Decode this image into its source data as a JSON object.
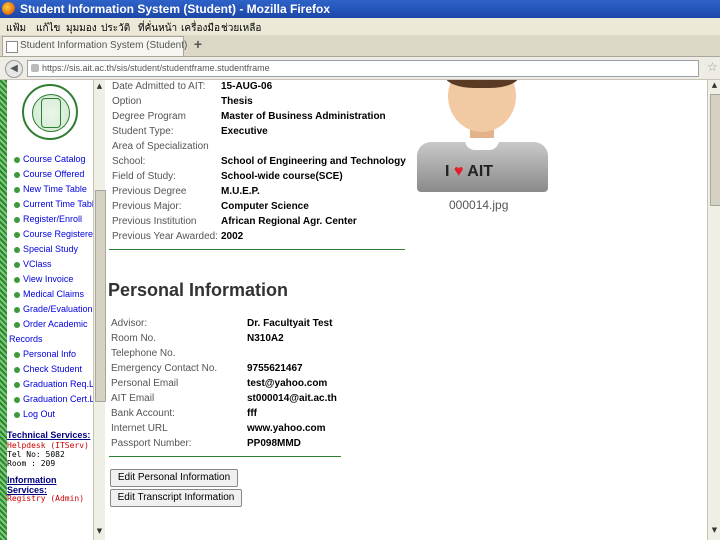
{
  "window": {
    "title": "Student Information System (Student) - Mozilla Firefox"
  },
  "menu": {
    "items": [
      "แฟ้ม",
      "แก้ไข",
      "มุมมอง",
      "ประวัติ",
      "ที่คั่นหน้า",
      "เครื่องมือ",
      "ช่วยเหลือ"
    ]
  },
  "tab": {
    "label": "Student Information System (Student)",
    "new_tab": "+"
  },
  "nav": {
    "url": "https://sis.ait.ac.th/sis/student/studentframe.studentframe"
  },
  "sidebar": {
    "items": [
      "Course Catalog",
      "Course Offered",
      "New Time Table",
      "Current Time Table",
      "Register/Enroll",
      "Course Registered",
      "Special Study",
      "VClass",
      "View Invoice",
      "Medical Claims",
      "Grade/Evaluation",
      "Order Academic"
    ],
    "records": "Records",
    "items2": [
      "Personal Info",
      "Check Student",
      "Graduation Req.Link",
      "Graduation Cert.Link",
      "Log Out"
    ],
    "tech": {
      "heading": "Technical Services:",
      "line1": "Helpdesk (ITServ)",
      "line2": "Tel No: 5082",
      "line3": "Room : 209"
    },
    "infoserv": {
      "heading1": "Information",
      "heading2": "Services:",
      "line1": "Registry (Admin)"
    }
  },
  "academic": [
    {
      "label": "Date Admitted to AIT:",
      "value": "15-AUG-06"
    },
    {
      "label": "Option",
      "value": "Thesis"
    },
    {
      "label": "Degree Program",
      "value": "Master of Business Administration"
    },
    {
      "label": "Student Type:",
      "value": "Executive"
    },
    {
      "label": "Area of Specialization",
      "value": ""
    },
    {
      "label": "School:",
      "value": "School of Engineering and Technology"
    },
    {
      "label": "Field of Study:",
      "value": "School-wide course(SCE)"
    },
    {
      "label": "Previous Degree",
      "value": "M.U.E.P."
    },
    {
      "label": "Previous Major:",
      "value": "Computer Science"
    },
    {
      "label": "Previous Institution",
      "value": "African Regional Agr. Center"
    },
    {
      "label": "Previous Year Awarded:",
      "value": "2002"
    }
  ],
  "personal": {
    "title": "Personal Information",
    "rows": [
      {
        "label": "Advisor:",
        "value": "Dr. Facultyait Test"
      },
      {
        "label": "Room No.",
        "value": "N310A2"
      },
      {
        "label": "Telephone No.",
        "value": ""
      },
      {
        "label": "Emergency Contact No.",
        "value": "9755621467"
      },
      {
        "label": "Personal Email",
        "value": "test@yahoo.com"
      },
      {
        "label": "AIT Email",
        "value": "st000014@ait.ac.th"
      },
      {
        "label": "Bank Account:",
        "value": "fff"
      },
      {
        "label": "Internet URL",
        "value": "www.yahoo.com"
      },
      {
        "label": "Passport Number:",
        "value": "PP098MMD"
      }
    ],
    "edit_personal": "Edit Personal Information",
    "edit_transcript": "Edit Transcript Information"
  },
  "photo": {
    "caption": "000014.jpg",
    "text_i": "I",
    "text_ait": "AIT"
  },
  "icons": [
    "firefox-icon",
    "page-icon",
    "back-arrow-icon",
    "globe-icon",
    "star-icon",
    "heart-icon",
    "ait-logo"
  ],
  "colors": {
    "titlebar": "#1b47a8",
    "link": "#0000dd",
    "accent": "#2e7d32",
    "alert": "#cc0000"
  }
}
